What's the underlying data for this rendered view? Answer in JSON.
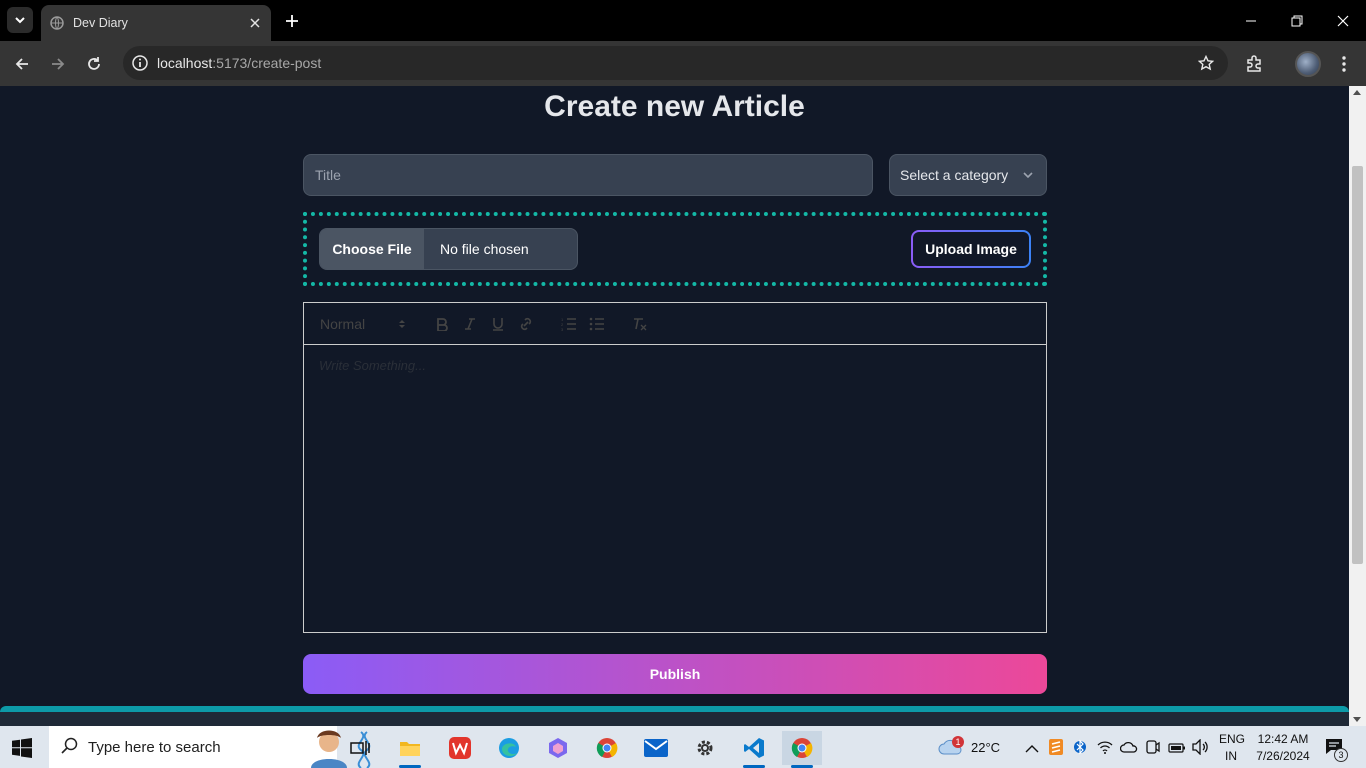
{
  "browser": {
    "tab_title": "Dev Diary",
    "url_host": "localhost",
    "url_path": ":5173/create-post"
  },
  "page": {
    "heading": "Create new Article",
    "title_placeholder": "Title",
    "category_label": "Select a category",
    "choose_file_label": "Choose File",
    "no_file_text": "No file chosen",
    "upload_label": "Upload Image",
    "editor": {
      "format_label": "Normal",
      "placeholder": "Write Something..."
    },
    "publish_label": "Publish"
  },
  "taskbar": {
    "search_placeholder": "Type here to search",
    "weather": "22°C",
    "weather_badge": "1",
    "language_line1": "ENG",
    "language_line2": "IN",
    "time": "12:42 AM",
    "date": "7/26/2024",
    "notification_count": "3"
  },
  "colors": {
    "page_bg": "#111827",
    "accent_teal": "#14b8a6",
    "publish_gradient_start": "#8b5cf6",
    "publish_gradient_end": "#ec4899"
  }
}
